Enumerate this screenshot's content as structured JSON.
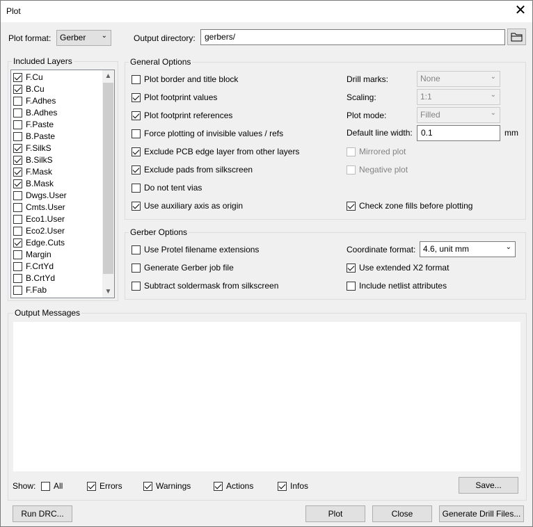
{
  "window": {
    "title": "Plot",
    "close_glyph": "✕"
  },
  "top": {
    "plot_format_label": "Plot format:",
    "plot_format_value": "Gerber",
    "output_dir_label": "Output directory:",
    "output_dir_value": "gerbers/"
  },
  "layers": {
    "title": "Included Layers",
    "items": [
      {
        "label": "F.Cu",
        "checked": true
      },
      {
        "label": "B.Cu",
        "checked": true
      },
      {
        "label": "F.Adhes",
        "checked": false
      },
      {
        "label": "B.Adhes",
        "checked": false
      },
      {
        "label": "F.Paste",
        "checked": false
      },
      {
        "label": "B.Paste",
        "checked": false
      },
      {
        "label": "F.SilkS",
        "checked": true
      },
      {
        "label": "B.SilkS",
        "checked": true
      },
      {
        "label": "F.Mask",
        "checked": true
      },
      {
        "label": "B.Mask",
        "checked": true
      },
      {
        "label": "Dwgs.User",
        "checked": false
      },
      {
        "label": "Cmts.User",
        "checked": false
      },
      {
        "label": "Eco1.User",
        "checked": false
      },
      {
        "label": "Eco2.User",
        "checked": false
      },
      {
        "label": "Edge.Cuts",
        "checked": true
      },
      {
        "label": "Margin",
        "checked": false
      },
      {
        "label": "F.CrtYd",
        "checked": false
      },
      {
        "label": "B.CrtYd",
        "checked": false
      },
      {
        "label": "F.Fab",
        "checked": false
      }
    ]
  },
  "general": {
    "title": "General Options",
    "options": [
      {
        "label": "Plot border and title block",
        "checked": false
      },
      {
        "label": "Plot footprint values",
        "checked": true
      },
      {
        "label": "Plot footprint references",
        "checked": true
      },
      {
        "label": "Force plotting of invisible values / refs",
        "checked": false
      },
      {
        "label": "Exclude PCB edge layer from other layers",
        "checked": true
      },
      {
        "label": "Exclude pads from silkscreen",
        "checked": true
      },
      {
        "label": "Do not tent vias",
        "checked": false
      },
      {
        "label": "Use auxiliary axis as origin",
        "checked": true
      }
    ],
    "drill_marks_label": "Drill marks:",
    "drill_marks_value": "None",
    "scaling_label": "Scaling:",
    "scaling_value": "1:1",
    "plot_mode_label": "Plot mode:",
    "plot_mode_value": "Filled",
    "line_width_label": "Default line width:",
    "line_width_value": "0.1",
    "line_width_unit": "mm",
    "mirrored_label": "Mirrored plot",
    "negative_label": "Negative plot",
    "zone_fills_label": "Check zone fills before plotting"
  },
  "gerber": {
    "title": "Gerber Options",
    "protel_label": "Use Protel filename extensions",
    "job_file_label": "Generate Gerber job file",
    "subtract_label": "Subtract soldermask from silkscreen",
    "coord_label": "Coordinate format:",
    "coord_value": "4.6, unit mm",
    "x2_label": "Use extended X2 format",
    "netlist_label": "Include netlist attributes"
  },
  "messages": {
    "title": "Output Messages",
    "show_label": "Show:",
    "all_label": "All",
    "errors_label": "Errors",
    "warnings_label": "Warnings",
    "actions_label": "Actions",
    "infos_label": "Infos",
    "save_label": "Save..."
  },
  "buttons": {
    "run_drc": "Run DRC...",
    "plot": "Plot",
    "close": "Close",
    "drill": "Generate Drill Files..."
  },
  "icons": {
    "folder": "folder-icon",
    "close": "close-icon",
    "dropdown": "chevron-down-icon"
  }
}
